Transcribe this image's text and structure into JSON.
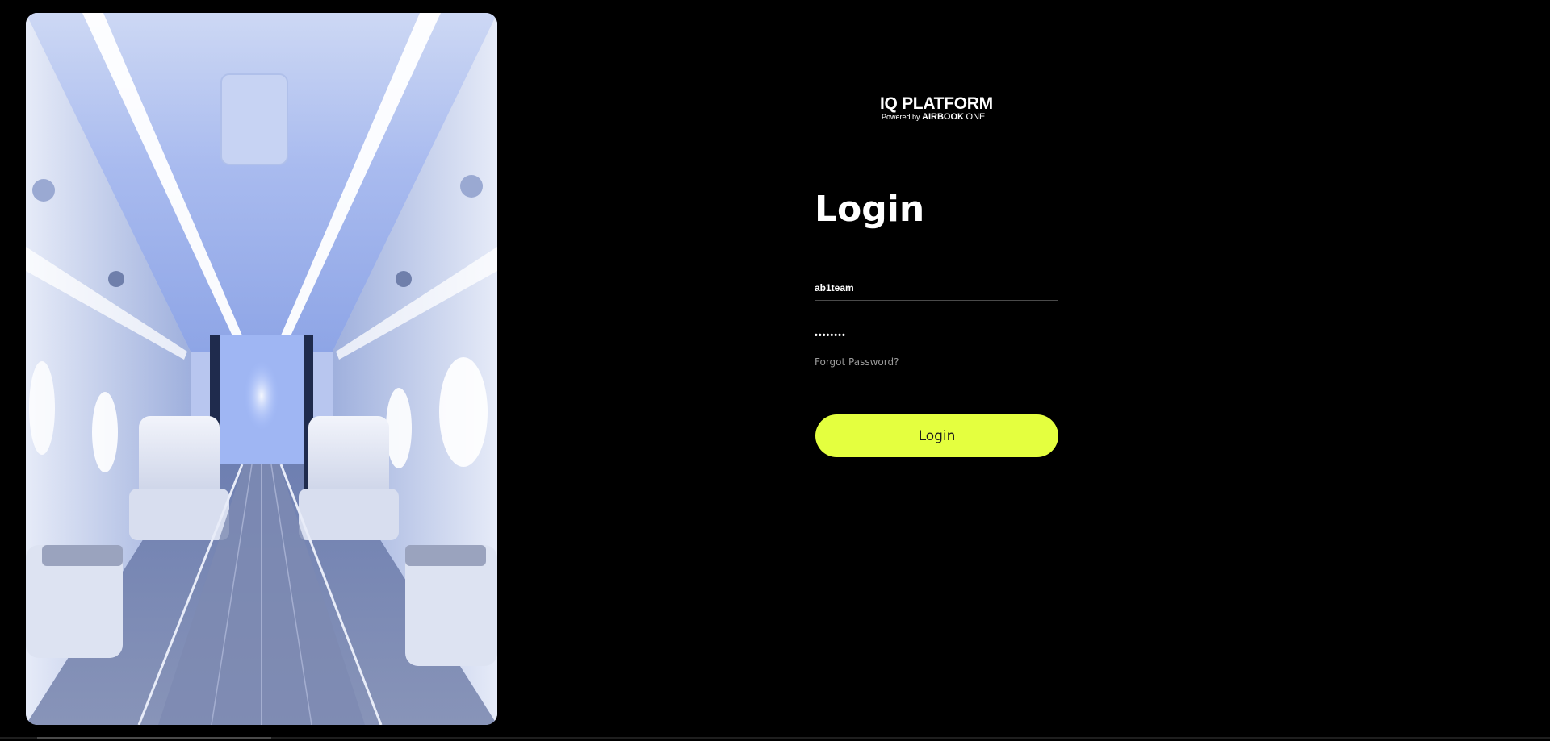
{
  "brand": {
    "title": "IQ PLATFORM",
    "powered_by": "Powered by",
    "company": "AIRBOOK",
    "company_suffix": "ONE"
  },
  "login": {
    "heading": "Login",
    "username_value": "ab1team",
    "password_value": "••••••••",
    "forgot_label": "Forgot Password?",
    "submit_label": "Login"
  },
  "colors": {
    "background": "#000000",
    "accent": "#e4ff3f",
    "muted_text": "#9b9b9b"
  }
}
